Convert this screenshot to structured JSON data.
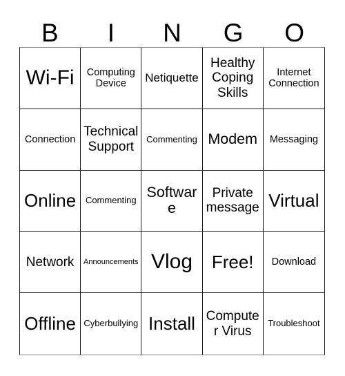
{
  "card": {
    "header_letters": [
      "B",
      "I",
      "N",
      "G",
      "O"
    ],
    "grid": {
      "rows": 5,
      "columns": 5,
      "cells": [
        [
          {
            "label": "Wi-Fi",
            "size": "fs-xxl"
          },
          {
            "label": "Computing Device",
            "size": "fs-s"
          },
          {
            "label": "Netiquette",
            "size": "fs-m"
          },
          {
            "label": "Healthy Coping Skills",
            "size": "fs-ml"
          },
          {
            "label": "Internet Connection",
            "size": "fs-s"
          }
        ],
        [
          {
            "label": "Connection",
            "size": "fs-s"
          },
          {
            "label": "Technical Support",
            "size": "fs-ml"
          },
          {
            "label": "Commenting",
            "size": "fs-xs"
          },
          {
            "label": "Modem",
            "size": "fs-l"
          },
          {
            "label": "Messaging",
            "size": "fs-s"
          }
        ],
        [
          {
            "label": "Online",
            "size": "fs-xl"
          },
          {
            "label": "Commenting",
            "size": "fs-xs"
          },
          {
            "label": "Software",
            "size": "fs-l"
          },
          {
            "label": "Private message",
            "size": "fs-ml"
          },
          {
            "label": "Virtual",
            "size": "fs-xl"
          }
        ],
        [
          {
            "label": "Network",
            "size": "fs-ml"
          },
          {
            "label": "Announcements",
            "size": "fs-xxs"
          },
          {
            "label": "Vlog",
            "size": "fs-xxl"
          },
          {
            "label": "Free!",
            "size": "fs-xl"
          },
          {
            "label": "Download",
            "size": "fs-s"
          }
        ],
        [
          {
            "label": "Offline",
            "size": "fs-xl"
          },
          {
            "label": "Cyberbullying",
            "size": "fs-xs"
          },
          {
            "label": "Install",
            "size": "fs-xl"
          },
          {
            "label": "Computer Virus",
            "size": "fs-ml"
          },
          {
            "label": "Troubleshoot",
            "size": "fs-xs"
          }
        ]
      ]
    },
    "colors": {
      "background": "#ffffff",
      "text": "#000000",
      "grid_line": "#1a1a1a",
      "outer_line": "#808080"
    }
  }
}
